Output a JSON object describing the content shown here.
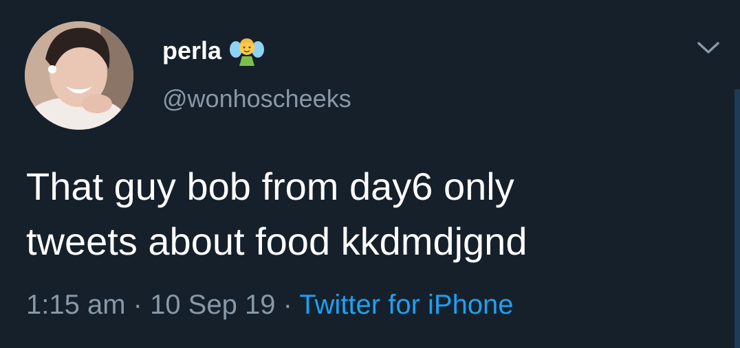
{
  "tweet": {
    "display_name": "perla",
    "name_emoji": "fairy-emoji",
    "handle": "@wonhoscheeks",
    "text_line1": "That guy bob from day6 only",
    "text_line2": "tweets about food kkdmdjgnd",
    "time": "1:15 am",
    "separator": " · ",
    "date": "10 Sep 19",
    "separator2": " · ",
    "source": "Twitter for iPhone"
  },
  "icons": {
    "menu": "chevron-down-icon",
    "avatar": "profile-photo"
  },
  "colors": {
    "background": "#15202b",
    "primary_text": "#ffffff",
    "secondary_text": "#8899a6",
    "link": "#1da1f2"
  }
}
